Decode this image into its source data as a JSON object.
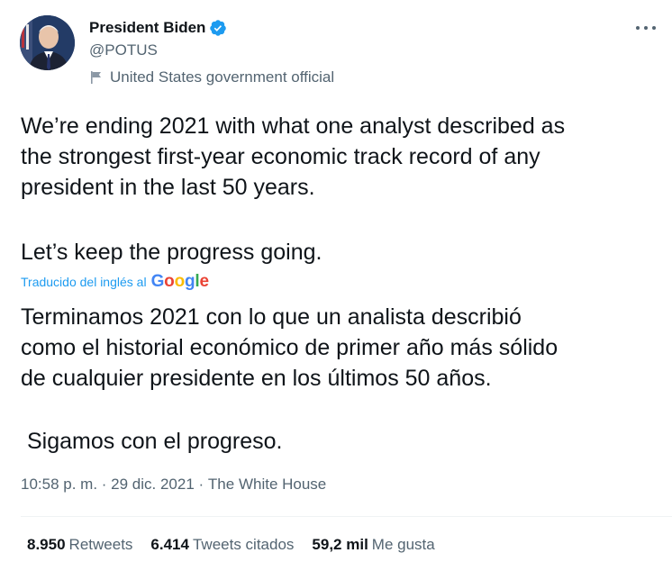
{
  "author": {
    "name": "President Biden",
    "handle": "@POTUS",
    "label": "United States government official",
    "verified": true
  },
  "tweet": {
    "text_en_p1": "We’re ending 2021 with what one analyst described as\nthe strongest first-year economic track record of any\npresident in the last 50 years.",
    "text_en_p2": "Let’s keep the progress going.",
    "translated_label": "Traducido del inglés al",
    "translator": "Google",
    "text_es_p1": "Terminamos 2021 con lo que un analista describió\ncomo el historial económico de primer año más sólido\nde cualquier presidente en los últimos 50 años.",
    "text_es_p2": "Sigamos con el progreso."
  },
  "meta": {
    "time": "10:58 p. m.",
    "sep1": " · ",
    "date": "29 dic. 2021",
    "sep2": " · ",
    "source": "The White House"
  },
  "stats": {
    "retweets_count": "8.950",
    "retweets_label": "Retweets",
    "quotes_count": "6.414",
    "quotes_label": "Tweets citados",
    "likes_count": "59,2 mil",
    "likes_label": "Me gusta"
  },
  "colors": {
    "verified": "#1d9bf0",
    "link": "#1d9bf0",
    "secondary_text": "#536471",
    "primary_text": "#0f1419"
  },
  "icons": {
    "verified": "verified-badge-icon",
    "label": "flag-icon",
    "more": "more-options-icon"
  }
}
